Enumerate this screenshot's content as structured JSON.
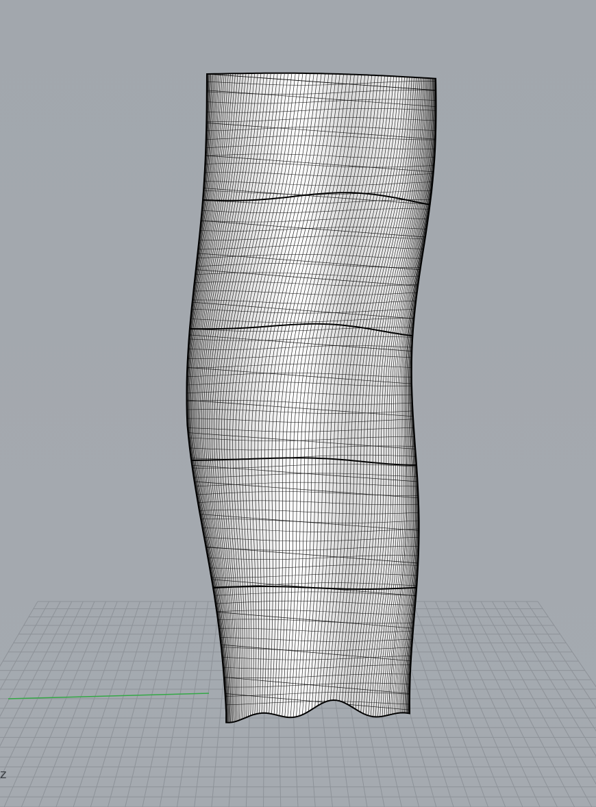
{
  "viewport": {
    "background": "#a3a8ae",
    "grid_color": "#8d9298",
    "x_axis_color": "#33a845",
    "model_fill": "#f2f2f2",
    "isocurve_color": "#000000",
    "display_mode": "shaded-with-isocurves"
  },
  "axes": {
    "z_label": "z"
  }
}
